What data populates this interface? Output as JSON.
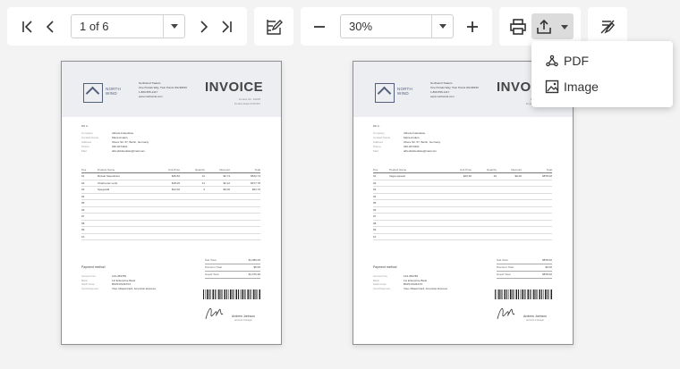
{
  "toolbar": {
    "page_selector": {
      "value": "1 of 6"
    },
    "zoom_selector": {
      "value": "30%"
    }
  },
  "export_menu": {
    "items": [
      {
        "label": "PDF",
        "icon": "pdf-icon"
      },
      {
        "label": "Image",
        "icon": "image-icon"
      }
    ]
  },
  "pages": [
    {
      "title": "INVOICE",
      "logo_text": [
        "NORTH",
        "WIND"
      ],
      "company_address": [
        "Northwind Traders",
        "One Portals Way, Twin Points WA 98156",
        "1-800-555-1417",
        "www.northwind.com"
      ],
      "meta": [
        "Invoice No. 10248",
        "Invoice Date 07/04/21"
      ],
      "bill_to_label": "Bill to",
      "bill_to": [
        {
          "k": "Company",
          "v": "Alfreds Futterkiste"
        },
        {
          "k": "Contact Name",
          "v": "Maria Anders"
        },
        {
          "k": "Address",
          "v": "Obere Str. 57, Berlin, Germany"
        },
        {
          "k": "Phone",
          "v": "030-0074321"
        },
        {
          "k": "Mail",
          "v": "alfredsfutterkiste@mail.com"
        }
      ],
      "table_headers": [
        "Pos.",
        "Product Name",
        "Unit Price",
        "Quantity",
        "Discount",
        "Total"
      ],
      "rows": [
        [
          "01",
          "Rössle Sauerkraut",
          "$45.60",
          "12",
          "$2.73",
          "$543.73"
        ],
        [
          "02",
          "Chartreuse verte",
          "$18.00",
          "21",
          "$2.22",
          "$377.78"
        ],
        [
          "03",
          "Spegesild",
          "$12.00",
          "2",
          "$0.00",
          "$23.70"
        ],
        [
          "04",
          "",
          "",
          "",
          "",
          ""
        ],
        [
          "05",
          "",
          "",
          "",
          "",
          ""
        ],
        [
          "06",
          "",
          "",
          "",
          "",
          ""
        ],
        [
          "07",
          "",
          "",
          "",
          "",
          ""
        ],
        [
          "08",
          "",
          "",
          "",
          "",
          ""
        ],
        [
          "09",
          "",
          "",
          "",
          "",
          ""
        ],
        [
          "10",
          "",
          "",
          "",
          "",
          ""
        ]
      ],
      "totals": [
        {
          "k": "Sub Total",
          "v": "$1,086.00"
        },
        {
          "k": "Discount Total",
          "v": "$5.00"
        },
        {
          "k": "Grand Total",
          "v": "$1,076.30"
        }
      ],
      "payment_label": "Payment method",
      "payment": [
        {
          "k": "Account No.",
          "v": "123-456789"
        },
        {
          "k": "Bank",
          "v": "1st Enterprise Bank"
        },
        {
          "k": "Swift Code",
          "v": "BKPFUS33XXX"
        },
        {
          "k": "Card Payment",
          "v": "Visa, MasterCard, American Express"
        }
      ],
      "signature_name": "Andrew Jonhson",
      "signature_role": "account manager"
    },
    {
      "title": "INVOICE",
      "logo_text": [
        "NORTH",
        "WIND"
      ],
      "company_address": [
        "Northwind Traders",
        "One Portals Way, Twin Points WA 98156",
        "1-800-555-1417",
        "www.northwind.com"
      ],
      "meta": [
        "Invoice No. 10249",
        "Invoice Date 07/05/21"
      ],
      "bill_to_label": "Bill to",
      "bill_to": [
        {
          "k": "Company",
          "v": "Alfreds Futterkiste"
        },
        {
          "k": "Contact Name",
          "v": "Maria Anders"
        },
        {
          "k": "Address",
          "v": "Obere Str. 57, Berlin, Germany"
        },
        {
          "k": "Phone",
          "v": "030-0074321"
        },
        {
          "k": "Mail",
          "v": "alfredsfutterkiste@mail.com"
        }
      ],
      "table_headers": [
        "Pos.",
        "Product Name",
        "Unit Price",
        "Quantity",
        "Discount",
        "Total"
      ],
      "rows": [
        [
          "01",
          "Vegie-spread",
          "$43.90",
          "20",
          "$0.00",
          "$878.00"
        ],
        [
          "02",
          "",
          "",
          "",
          "",
          ""
        ],
        [
          "03",
          "",
          "",
          "",
          "",
          ""
        ],
        [
          "04",
          "",
          "",
          "",
          "",
          ""
        ],
        [
          "05",
          "",
          "",
          "",
          "",
          ""
        ],
        [
          "06",
          "",
          "",
          "",
          "",
          ""
        ],
        [
          "07",
          "",
          "",
          "",
          "",
          ""
        ],
        [
          "08",
          "",
          "",
          "",
          "",
          ""
        ],
        [
          "09",
          "",
          "",
          "",
          "",
          ""
        ],
        [
          "10",
          "",
          "",
          "",
          "",
          ""
        ]
      ],
      "totals": [
        {
          "k": "Sub Total",
          "v": "$878.00"
        },
        {
          "k": "Discount Total",
          "v": "$0.00"
        },
        {
          "k": "Grand Total",
          "v": "$878.00"
        }
      ],
      "payment_label": "Payment method",
      "payment": [
        {
          "k": "Account No.",
          "v": "123-456789"
        },
        {
          "k": "Bank",
          "v": "1st Enterprise Bank"
        },
        {
          "k": "Swift Code",
          "v": "BKPFUS33XXX"
        },
        {
          "k": "Card Payment",
          "v": "Visa, MasterCard, American Express"
        }
      ],
      "signature_name": "Andrew Jonhson",
      "signature_role": "account manager"
    }
  ]
}
